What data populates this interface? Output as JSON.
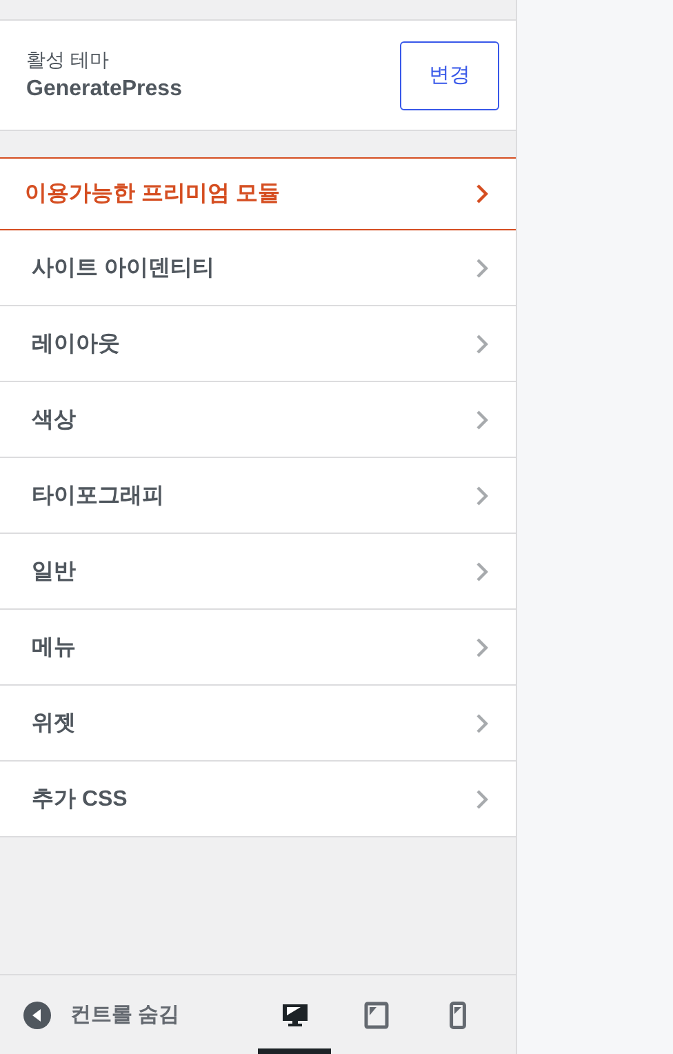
{
  "theme": {
    "label": "활성 테마",
    "name": "GeneratePress",
    "button": "변경"
  },
  "sections": [
    {
      "label": "이용가능한 프리미엄 모듈",
      "kind": "premium"
    },
    {
      "label": "사이트 아이덴티티",
      "kind": "section"
    },
    {
      "label": "레이아웃",
      "kind": "section"
    },
    {
      "label": "색상",
      "kind": "section"
    },
    {
      "label": "타이포그래피",
      "kind": "section"
    },
    {
      "label": "일반",
      "kind": "section"
    },
    {
      "label": "메뉴",
      "kind": "section"
    },
    {
      "label": "위젯",
      "kind": "section"
    },
    {
      "label": "추가 CSS",
      "kind": "section"
    }
  ],
  "footer": {
    "hide_label": "컨트롤 숨김",
    "devices": [
      {
        "kind": "desktop",
        "selected": true
      },
      {
        "kind": "tablet",
        "selected": false
      },
      {
        "kind": "mobile",
        "selected": false
      }
    ]
  }
}
